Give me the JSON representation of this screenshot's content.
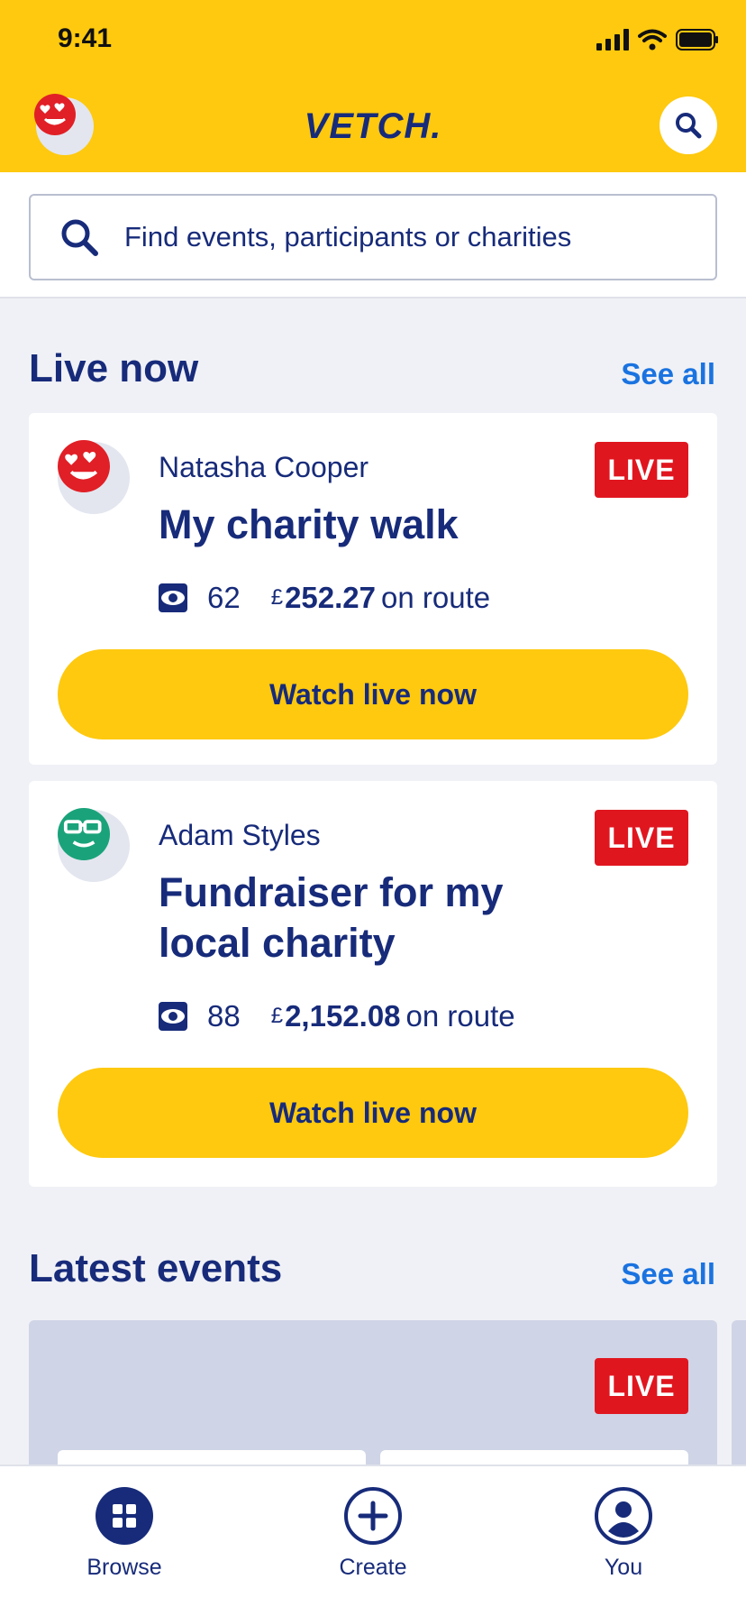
{
  "status_bar": {
    "time": "9:41"
  },
  "header": {
    "brand": "VETCH.",
    "avatar_icon": "emoji-heart-eyes-icon",
    "search_icon": "search-icon"
  },
  "search": {
    "placeholder": "Find events, participants or charities",
    "value": ""
  },
  "live_now": {
    "title": "Live now",
    "see_all": "See all",
    "items": [
      {
        "name": "Natasha Cooper",
        "title": "My charity walk",
        "badge": "LIVE",
        "viewers": "62",
        "currency": "£",
        "amount": "252.27",
        "suffix": "on route",
        "button": "Watch live now",
        "avatar_icon": "emoji-heart-eyes-icon",
        "avatar_color": "#e11f26"
      },
      {
        "name": "Adam Styles",
        "title": "Fundraiser for my local charity",
        "badge": "LIVE",
        "viewers": "88",
        "currency": "£",
        "amount": "2,152.08",
        "suffix": "on route",
        "button": "Watch live now",
        "avatar_icon": "emoji-glasses-icon",
        "avatar_color": "#1aa37a"
      }
    ]
  },
  "latest_events": {
    "title": "Latest events",
    "see_all": "See all",
    "badge": "LIVE"
  },
  "tab_bar": {
    "items": [
      {
        "label": "Browse",
        "icon": "grid-icon"
      },
      {
        "label": "Create",
        "icon": "plus-circle-icon"
      },
      {
        "label": "You",
        "icon": "user-icon"
      }
    ]
  },
  "colors": {
    "brand_yellow": "#fec90f",
    "navy": "#172b7a",
    "live_red": "#e0161f",
    "link_blue": "#1a73e0"
  }
}
